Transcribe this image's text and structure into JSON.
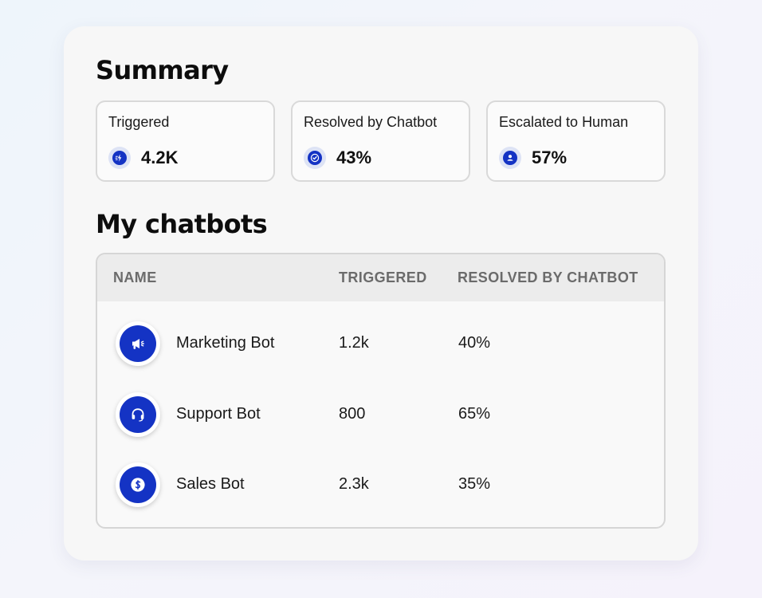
{
  "summary": {
    "title": "Summary",
    "cards": [
      {
        "label": "Triggered",
        "value": "4.2K",
        "icon": "lightning-icon"
      },
      {
        "label": "Resolved by Chatbot",
        "value": "43%",
        "icon": "check-circle-icon"
      },
      {
        "label": "Escalated to Human",
        "value": "57%",
        "icon": "user-icon"
      }
    ]
  },
  "chatbots": {
    "title": "My chatbots",
    "columns": [
      "NAME",
      "TRIGGERED",
      "RESOLVED BY CHATBOT"
    ],
    "rows": [
      {
        "name": "Marketing Bot",
        "triggered": "1.2k",
        "resolved": "40%",
        "icon": "megaphone-icon"
      },
      {
        "name": "Support Bot",
        "triggered": "800",
        "resolved": "65%",
        "icon": "headset-icon"
      },
      {
        "name": "Sales Bot",
        "triggered": "2.3k",
        "resolved": "35%",
        "icon": "dollar-icon"
      }
    ]
  },
  "colors": {
    "accent": "#1433c4",
    "icon_ring": "#dde3f5",
    "header_bg": "#ececec",
    "header_text": "#6b6b6b"
  }
}
